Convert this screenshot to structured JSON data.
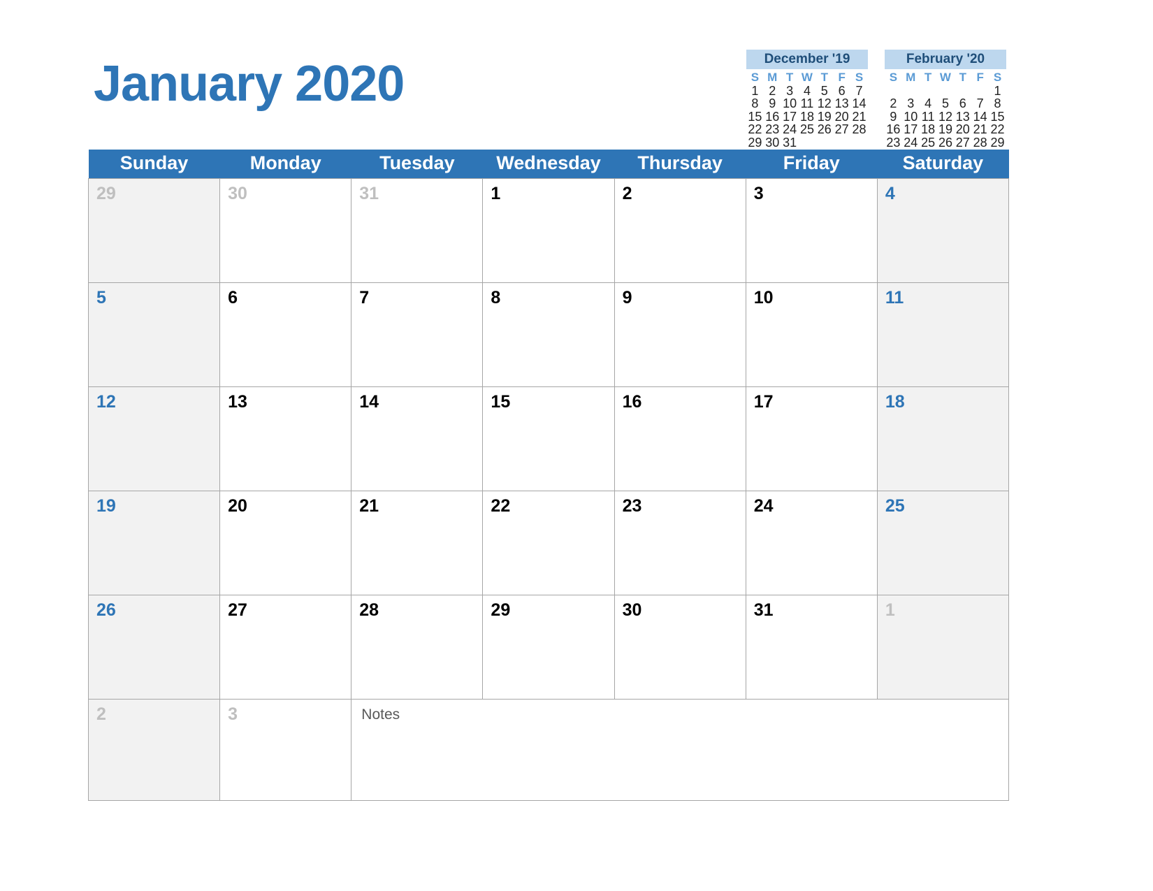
{
  "title": "January 2020",
  "colors": {
    "header_blue": "#2E75B6",
    "mini_header_blue": "#BDD7EE",
    "mini_title_text": "#1F4E79",
    "weekend_bg": "#F2F2F2",
    "muted_text": "#BFBFBF",
    "grid_border": "#A6A6A6"
  },
  "mini_calendars": [
    {
      "name": "december-2019",
      "title": "December '19",
      "daynames": [
        "S",
        "M",
        "T",
        "W",
        "T",
        "F",
        "S"
      ],
      "weeks": [
        [
          "1",
          "2",
          "3",
          "4",
          "5",
          "6",
          "7"
        ],
        [
          "8",
          "9",
          "10",
          "11",
          "12",
          "13",
          "14"
        ],
        [
          "15",
          "16",
          "17",
          "18",
          "19",
          "20",
          "21"
        ],
        [
          "22",
          "23",
          "24",
          "25",
          "26",
          "27",
          "28"
        ],
        [
          "29",
          "30",
          "31",
          "",
          "",
          "",
          ""
        ]
      ]
    },
    {
      "name": "february-2020",
      "title": "February '20",
      "daynames": [
        "S",
        "M",
        "T",
        "W",
        "T",
        "F",
        "S"
      ],
      "weeks": [
        [
          "",
          "",
          "",
          "",
          "",
          "",
          "1"
        ],
        [
          "2",
          "3",
          "4",
          "5",
          "6",
          "7",
          "8"
        ],
        [
          "9",
          "10",
          "11",
          "12",
          "13",
          "14",
          "15"
        ],
        [
          "16",
          "17",
          "18",
          "19",
          "20",
          "21",
          "22"
        ],
        [
          "23",
          "24",
          "25",
          "26",
          "27",
          "28",
          "29"
        ]
      ]
    }
  ],
  "weekday_headers": [
    "Sunday",
    "Monday",
    "Tuesday",
    "Wednesday",
    "Thursday",
    "Friday",
    "Saturday"
  ],
  "notes_label": "Notes",
  "weeks": [
    [
      {
        "n": "29",
        "style": "muted"
      },
      {
        "n": "30",
        "style": "muted"
      },
      {
        "n": "31",
        "style": "muted"
      },
      {
        "n": "1",
        "style": "normal"
      },
      {
        "n": "2",
        "style": "normal"
      },
      {
        "n": "3",
        "style": "normal"
      },
      {
        "n": "4",
        "style": "blue"
      }
    ],
    [
      {
        "n": "5",
        "style": "blue"
      },
      {
        "n": "6",
        "style": "normal"
      },
      {
        "n": "7",
        "style": "normal"
      },
      {
        "n": "8",
        "style": "normal"
      },
      {
        "n": "9",
        "style": "normal"
      },
      {
        "n": "10",
        "style": "normal"
      },
      {
        "n": "11",
        "style": "blue"
      }
    ],
    [
      {
        "n": "12",
        "style": "blue"
      },
      {
        "n": "13",
        "style": "normal"
      },
      {
        "n": "14",
        "style": "normal"
      },
      {
        "n": "15",
        "style": "normal"
      },
      {
        "n": "16",
        "style": "normal"
      },
      {
        "n": "17",
        "style": "normal"
      },
      {
        "n": "18",
        "style": "blue"
      }
    ],
    [
      {
        "n": "19",
        "style": "blue"
      },
      {
        "n": "20",
        "style": "normal"
      },
      {
        "n": "21",
        "style": "normal"
      },
      {
        "n": "22",
        "style": "normal"
      },
      {
        "n": "23",
        "style": "normal"
      },
      {
        "n": "24",
        "style": "normal"
      },
      {
        "n": "25",
        "style": "blue"
      }
    ],
    [
      {
        "n": "26",
        "style": "blue"
      },
      {
        "n": "27",
        "style": "normal"
      },
      {
        "n": "28",
        "style": "normal"
      },
      {
        "n": "29",
        "style": "normal"
      },
      {
        "n": "30",
        "style": "normal"
      },
      {
        "n": "31",
        "style": "normal"
      },
      {
        "n": "1",
        "style": "muted"
      }
    ]
  ],
  "notes_row": [
    {
      "n": "2",
      "style": "muted"
    },
    {
      "n": "3",
      "style": "muted"
    }
  ]
}
